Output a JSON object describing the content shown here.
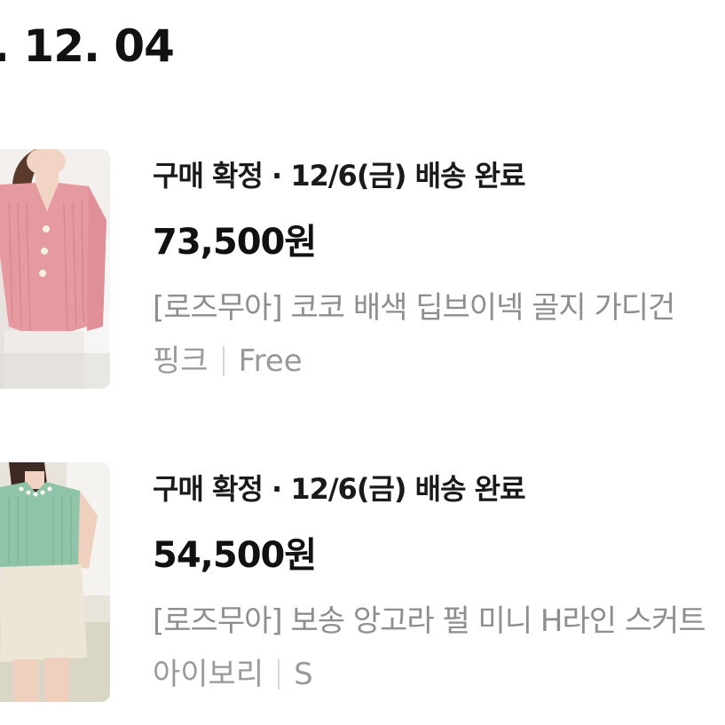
{
  "date_header": ". 12. 04",
  "orders": [
    {
      "status": "구매 확정 · 12/6(금) 배송 완료",
      "price": "73,500원",
      "product_name": "[로즈무아] 코코 배색 딥브이넥 골지 가디건",
      "color": "핑크",
      "size": "Free",
      "thumbnail_icon": "product-photo-pink-cardigan"
    },
    {
      "status": "구매 확정 · 12/6(금) 배송 완료",
      "price": "54,500원",
      "product_name": "[로즈무아] 보송 앙고라 펄 미니 H라인 스커트",
      "color": "아이보리",
      "size": "S",
      "thumbnail_icon": "product-photo-mint-knit"
    }
  ]
}
